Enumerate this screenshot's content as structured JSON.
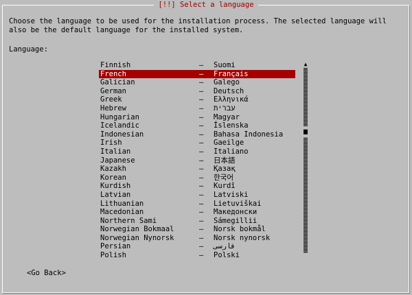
{
  "dialog": {
    "title": "[!!] Select a language",
    "intro": "Choose the language to be used for the installation process. The selected language will also be the default language for the installed system.",
    "list_label": "Language:",
    "separator": "–"
  },
  "languages": [
    {
      "english": "Finnish",
      "native": "Suomi",
      "selected": false
    },
    {
      "english": "French",
      "native": "Français",
      "selected": true
    },
    {
      "english": "Galician",
      "native": "Galego",
      "selected": false
    },
    {
      "english": "German",
      "native": "Deutsch",
      "selected": false
    },
    {
      "english": "Greek",
      "native": "Ελληνικά",
      "selected": false
    },
    {
      "english": "Hebrew",
      "native": "עברית",
      "selected": false
    },
    {
      "english": "Hungarian",
      "native": "Magyar",
      "selected": false
    },
    {
      "english": "Icelandic",
      "native": "Íslenska",
      "selected": false
    },
    {
      "english": "Indonesian",
      "native": "Bahasa Indonesia",
      "selected": false
    },
    {
      "english": "Irish",
      "native": "Gaeilge",
      "selected": false
    },
    {
      "english": "Italian",
      "native": "Italiano",
      "selected": false
    },
    {
      "english": "Japanese",
      "native": "日本語",
      "selected": false
    },
    {
      "english": "Kazakh",
      "native": "Қазақ",
      "selected": false
    },
    {
      "english": "Korean",
      "native": "한국어",
      "selected": false
    },
    {
      "english": "Kurdish",
      "native": "Kurdî",
      "selected": false
    },
    {
      "english": "Latvian",
      "native": "Latviski",
      "selected": false
    },
    {
      "english": "Lithuanian",
      "native": "Lietuviškai",
      "selected": false
    },
    {
      "english": "Macedonian",
      "native": "Македонски",
      "selected": false
    },
    {
      "english": "Northern Sami",
      "native": "Sámegillii",
      "selected": false
    },
    {
      "english": "Norwegian Bokmaal",
      "native": "Norsk bokmål",
      "selected": false
    },
    {
      "english": "Norwegian Nynorsk",
      "native": "Norsk nynorsk",
      "selected": false
    },
    {
      "english": "Persian",
      "native": "فارسی",
      "selected": false
    },
    {
      "english": "Polish",
      "native": "Polski",
      "selected": false
    }
  ],
  "scrollbar": {
    "position_fraction": 0.33,
    "up_arrow_icon": "scroll-up-arrow-icon"
  },
  "buttons": {
    "go_back": "<Go Back>"
  },
  "colors": {
    "background": "#bdbdbd",
    "selection": "#a50000",
    "title": "#a10000"
  }
}
